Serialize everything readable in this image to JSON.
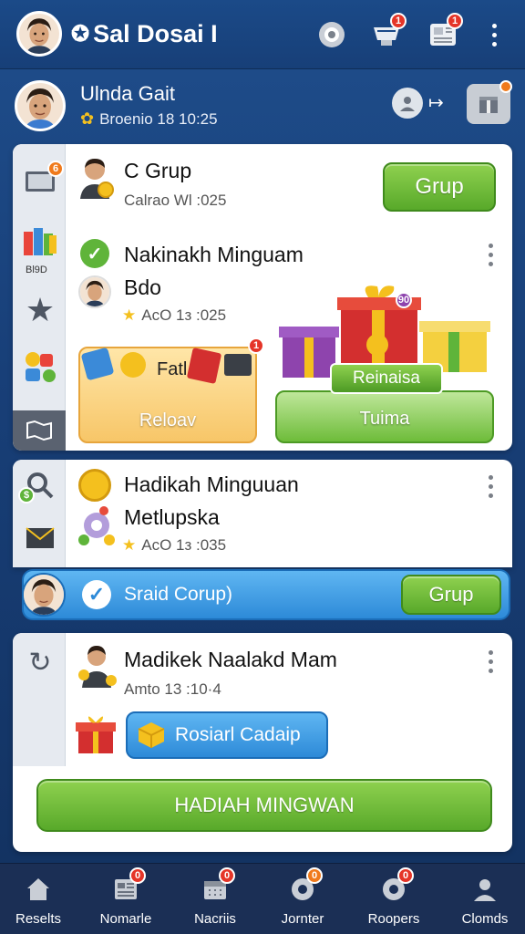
{
  "appbar": {
    "title": "Sal Dosai I",
    "icons": [
      "settings-icon",
      "inbox-icon",
      "newspaper-icon",
      "more-vert-icon"
    ],
    "badges": {
      "inbox": "1",
      "news": "1"
    }
  },
  "profile": {
    "name": "Ulnda Gait",
    "subtitle": "Broenio 18 10:25"
  },
  "card1": {
    "title": "C Grup",
    "meta": "Calrao Wl :025",
    "button": "Grup",
    "rail_badge": "6",
    "rail_label": "Bl9D"
  },
  "card1_item": {
    "title": "Nakinakh Minguam",
    "subtitle": "Bdo",
    "meta": "AсO 1з :025",
    "orange_panel_label": "Fatl",
    "orange_panel_button": "Reloav",
    "green_panel_label": "Reinaisa",
    "green_panel_button": "Tuima",
    "gift_badge": "90",
    "sticker_badge": "1"
  },
  "card2": {
    "title": "Hadikah Minguuan",
    "subtitle": "Metlupska",
    "meta": "AсO 1з :035"
  },
  "blue_bar": {
    "label": "Sraid Corup)",
    "button": "Grup"
  },
  "card3": {
    "title": "Madikek Naalakd Mam",
    "meta": "Amto 13 :10·4",
    "button": "Rosiarl Cadaip"
  },
  "main_button": "HADIAH MINGWAN",
  "nav": [
    {
      "label": "Reselts",
      "icon": "home-icon"
    },
    {
      "label": "Nomarle",
      "icon": "newspaper-icon",
      "badge": "0"
    },
    {
      "label": "Nacriis",
      "icon": "calendar-icon",
      "badge": "0"
    },
    {
      "label": "Jornter",
      "icon": "gear-icon",
      "badge": "0"
    },
    {
      "label": "Roopers",
      "icon": "gear-icon",
      "badge": "0"
    },
    {
      "label": "Clomds",
      "icon": "person-icon"
    }
  ],
  "colors": {
    "background": "#1f4e8c",
    "green_button": "#58a92a",
    "blue_bar": "#2d8ad8",
    "badge": "#e53528"
  }
}
